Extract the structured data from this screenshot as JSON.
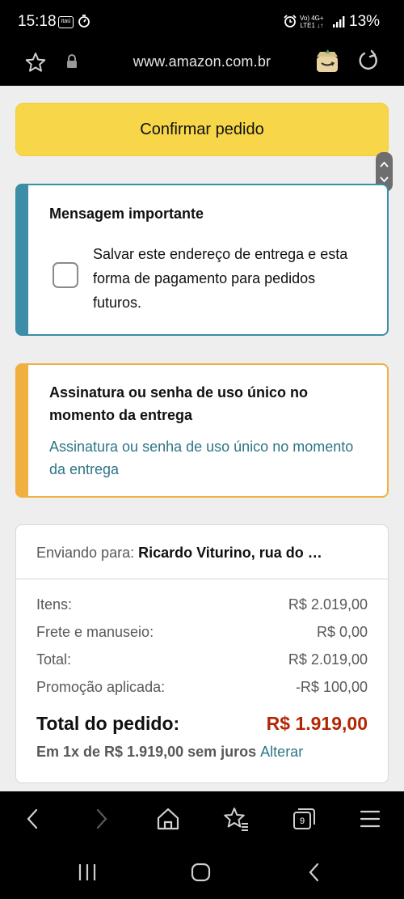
{
  "status_bar": {
    "time": "15:18",
    "bank_app": "itaú",
    "network_line1": "Vo) 4G+",
    "network_line2": "LTE1 ↓↑",
    "battery": "13%"
  },
  "browser": {
    "url": "www.amazon.com.br",
    "tab_count": "9"
  },
  "checkout": {
    "confirm_button": "Confirmar pedido",
    "important_message": {
      "title": "Mensagem importante",
      "checkbox_label": "Salvar este endereço de entrega e esta forma de pagamento para pedidos futuros.",
      "checked": false
    },
    "signature": {
      "title": "Assinatura ou senha de uso único no momento da entrega",
      "link": "Assinatura ou senha de uso único no momento da entrega"
    },
    "summary": {
      "shipping_label": "Enviando para:",
      "shipping_value": "Ricardo Viturino, rua do …",
      "rows": [
        {
          "label": "Itens:",
          "value": "R$ 2.019,00"
        },
        {
          "label": "Frete e manuseio:",
          "value": "R$ 0,00"
        },
        {
          "label": "Total:",
          "value": "R$ 2.019,00"
        },
        {
          "label": "Promoção aplicada:",
          "value": "-R$ 100,00"
        }
      ],
      "order_total_label": "Total do pedido:",
      "order_total_value": "R$ 1.919,00",
      "installments": "Em 1x de R$ 1.919,00 sem juros",
      "change_link": "Alterar"
    }
  },
  "colors": {
    "confirm_yellow": "#f7d749",
    "message_border": "#3b8da8",
    "signature_border": "#f0b040",
    "link_teal": "#2d7587",
    "price_red": "#b12704"
  }
}
